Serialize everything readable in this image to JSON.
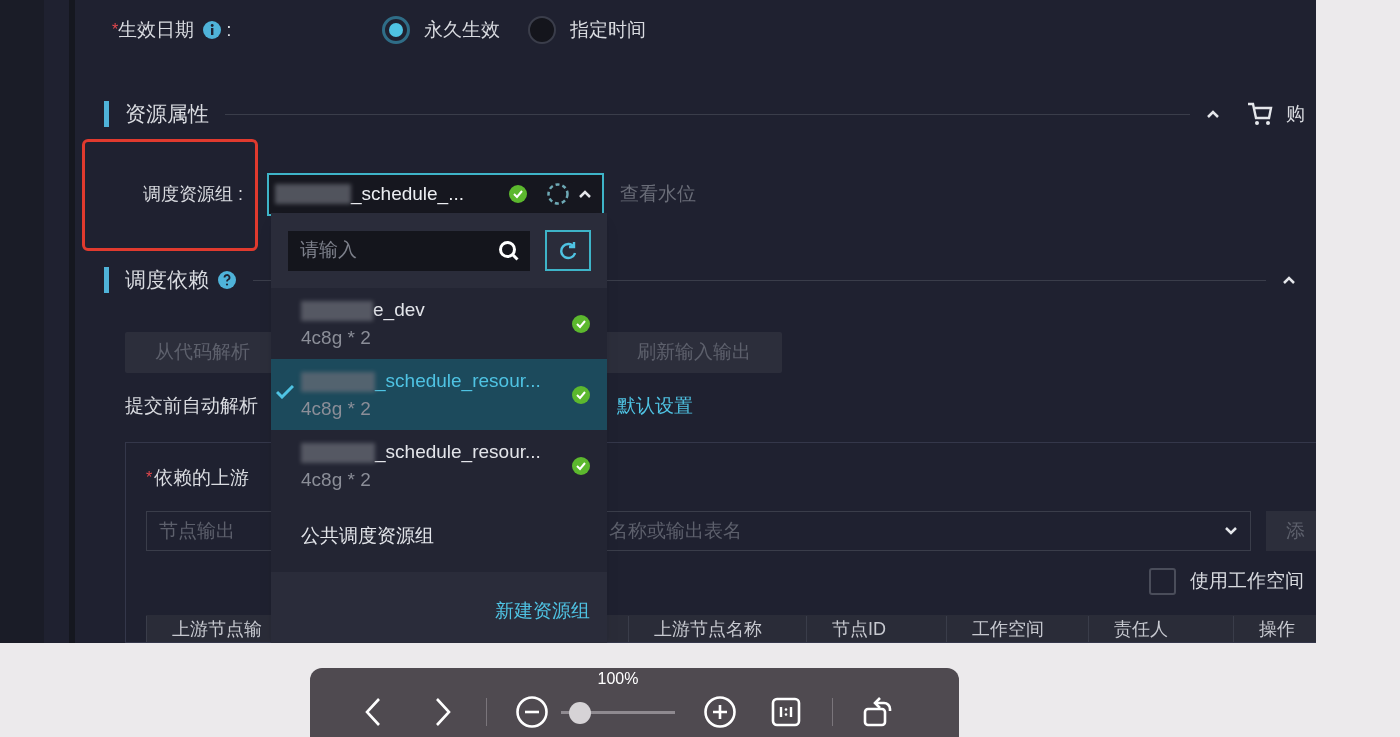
{
  "form": {
    "effective_date": {
      "required_mark": "*",
      "label": "生效日期",
      "colon": ":",
      "options": [
        {
          "label": "永久生效",
          "selected": true
        },
        {
          "label": "指定时间",
          "selected": false
        }
      ]
    },
    "resource_section": {
      "title": "资源属性",
      "expanded": true,
      "buy_label": "购"
    },
    "schedule_group": {
      "label": "调度资源组 :",
      "value": "_schedule_...",
      "status_ok": true,
      "loading": true,
      "open": true,
      "watermark_link": "查看水位"
    },
    "dependency_section": {
      "title": "调度依赖",
      "expanded": true,
      "buttons": [
        "从代码解析",
        "刷新输入输出"
      ],
      "auto_parse_text": "提交前自动解析",
      "default_link": "默认设置",
      "upstream": {
        "required_mark": "*",
        "label": "依赖的上游",
        "node_output_placeholder": "节点输出",
        "search_placeholder": "名称或输出表名",
        "add_button": "添",
        "workspace_checkbox": {
          "label": "使用工作空间",
          "checked": false
        },
        "columns": [
          "上游节点输",
          "上游节点名称",
          "节点ID",
          "工作空间",
          "责任人",
          "操作"
        ]
      }
    }
  },
  "dropdown": {
    "search_placeholder": "请输入",
    "options": [
      {
        "name": "e_dev",
        "spec": "4c8g * 2",
        "selected": false,
        "status_ok": true
      },
      {
        "name": "_schedule_resour...",
        "spec": "4c8g * 2",
        "selected": true,
        "status_ok": true
      },
      {
        "name": "_schedule_resour...",
        "spec": "4c8g * 2",
        "selected": false,
        "status_ok": true
      },
      {
        "name": "公共调度资源组",
        "selected": false,
        "status_ok": false
      }
    ],
    "footer_link": "新建资源组"
  },
  "viewer_toolbar": {
    "zoom": "100%",
    "level": 0.17
  }
}
